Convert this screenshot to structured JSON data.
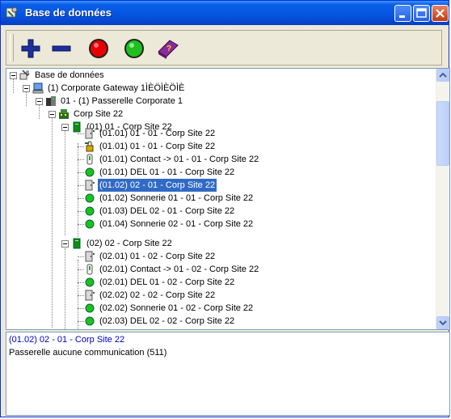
{
  "window": {
    "title": "Base de données"
  },
  "toolbar": {
    "buttons": [
      {
        "name": "add-button",
        "icon": "plus-icon"
      },
      {
        "name": "remove-button",
        "icon": "minus-icon"
      },
      {
        "name": "red-status-button",
        "icon": "red-circle-icon"
      },
      {
        "name": "green-status-button",
        "icon": "green-circle-icon"
      },
      {
        "name": "help-book-button",
        "icon": "help-book-icon"
      }
    ]
  },
  "tree": {
    "nodes": [
      {
        "label": "Base de données",
        "icon": "database-tools-icon"
      },
      {
        "label": "(1) Corporate Gateway 1ÌÈÖÌÈÖÌÈ",
        "icon": "computer-icon"
      },
      {
        "label": "01 - (1) Passerelle Corporate 1",
        "icon": "gateway-icon"
      },
      {
        "label": "Corp Site 22",
        "icon": "site-icon"
      },
      {
        "label": "(01) 01 - Corp Site 22",
        "icon": "green-module-icon"
      },
      {
        "label": "(01.01) 01 - 01 - Corp Site 22",
        "icon": "door-icon"
      },
      {
        "label": "(01.01) 01 - 01 - Corp Site 22",
        "icon": "lock-key-icon"
      },
      {
        "label": "(01.01) Contact -> 01 - 01 - Corp Site 22",
        "icon": "contact-icon"
      },
      {
        "label": "(01.01) DEL 01 - 01 - Corp Site 22",
        "icon": "green-led-icon"
      },
      {
        "label": "(01.02) 02 - 01 - Corp Site 22",
        "icon": "door-icon",
        "selected": true
      },
      {
        "label": "(01.02) Sonnerie 01 - 01 - Corp Site 22",
        "icon": "green-led-icon"
      },
      {
        "label": "(01.03) DEL 02 - 01 - Corp Site 22",
        "icon": "green-led-icon"
      },
      {
        "label": "(01.04) Sonnerie 02 - 01 - Corp Site 22",
        "icon": "green-led-icon"
      },
      {
        "label": "(02) 02 - Corp Site 22",
        "icon": "green-module-icon"
      },
      {
        "label": "(02.01) 01 - 02 - Corp Site 22",
        "icon": "door-icon"
      },
      {
        "label": "(02.01) Contact -> 01 - 02 - Corp Site 22",
        "icon": "contact-icon"
      },
      {
        "label": "(02.01) DEL 01 - 02 - Corp Site 22",
        "icon": "green-led-icon"
      },
      {
        "label": "(02.02) 02 - 02 - Corp Site 22",
        "icon": "door-icon"
      },
      {
        "label": "(02.02) Sonnerie 01 - 02 - Corp Site 22",
        "icon": "green-led-icon"
      },
      {
        "label": "(02.03) DEL 02 - 02 - Corp Site 22",
        "icon": "green-led-icon"
      }
    ]
  },
  "status": {
    "selected": "(01.02) 02 - 01 - Corp Site 22",
    "message": "Passerelle aucune communication (511)"
  },
  "colors": {
    "titlebar": "#0553e0",
    "selection": "#316ac5",
    "status_link": "#0000cc"
  }
}
